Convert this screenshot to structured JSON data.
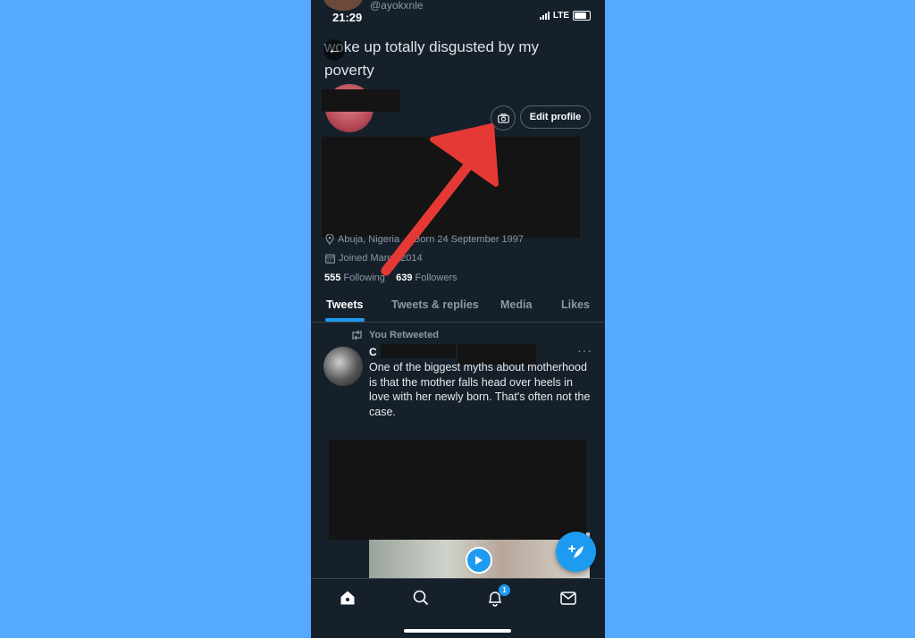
{
  "status_bar": {
    "time": "21:29",
    "network": "LTE"
  },
  "profile": {
    "handle": "@ayokxnle",
    "bio_heading": "woke up totally disgusted by my poverty",
    "edit_profile_label": "Edit profile",
    "location": "Abuja, Nigeria",
    "born": "Born 24 September 1997",
    "joined": "Joined March 2014",
    "following_count": "555",
    "following_label": "Following",
    "followers_count": "639",
    "followers_label": "Followers"
  },
  "tabs": [
    {
      "label": "Tweets",
      "active": true
    },
    {
      "label": "Tweets & replies",
      "active": false
    },
    {
      "label": "Media",
      "active": false
    },
    {
      "label": "Likes",
      "active": false
    }
  ],
  "tweet": {
    "retweet_label": "You Retweeted",
    "author_initial": "C",
    "text": "One of the biggest myths about motherhood is that the mother falls head over heels in love with her newly born. That's often not the case.",
    "more_label": "···"
  },
  "bottom_nav": {
    "notification_count": "1"
  },
  "colors": {
    "background": "#55aaff",
    "app_bg": "#15202b",
    "accent": "#1d9bf0",
    "annotation_arrow": "#e53935"
  },
  "icons": [
    "back-arrow-icon",
    "camera-icon",
    "location-pin-icon",
    "calendar-icon",
    "retweet-icon",
    "play-icon",
    "compose-icon",
    "home-icon",
    "search-icon",
    "bell-icon",
    "mail-icon"
  ]
}
